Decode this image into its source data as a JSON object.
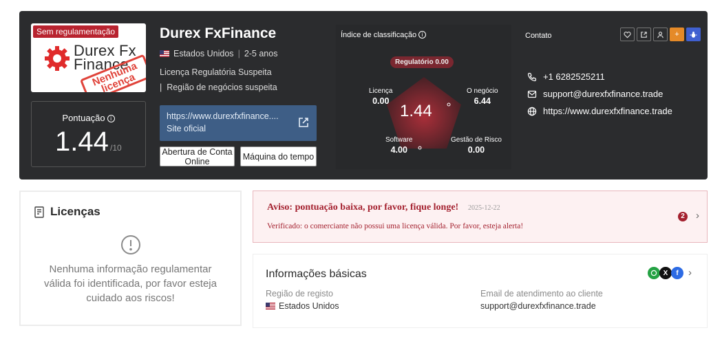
{
  "broker": {
    "unregulated_tag": "Sem regulamentação",
    "logo_text_line1": "Durex Fx",
    "logo_text_line2": "Finance",
    "stamp_line1": "Nenhuma",
    "stamp_line2": "licença",
    "name": "Durex FxFinance",
    "country": "Estados Unidos",
    "age": "2-5 anos",
    "license_status": "Licença Regulatória Suspeita",
    "region_status": "Região de negócios suspeita",
    "region_prefix": "|"
  },
  "score": {
    "label": "Pontuação",
    "value": "1.44",
    "max": "/10"
  },
  "website": {
    "url": "https://www.durexfxfinance....",
    "label": "Site oficial"
  },
  "actions": {
    "open_account": "Abertura de Conta Online",
    "time_machine": "Máquina do tempo"
  },
  "rating": {
    "title": "Índice de classificação",
    "regulatory_pill": "Regulatório 0.00",
    "center_score": "1.44",
    "axes": [
      {
        "label": "Licença",
        "value": "0.00"
      },
      {
        "label": "O negócio",
        "value": "6.44"
      },
      {
        "label": "Software",
        "value": "4.00"
      },
      {
        "label": "Gestão de Risco",
        "value": "0.00"
      }
    ]
  },
  "contact": {
    "title": "Contato",
    "phone": "+1 6282525211",
    "email": "support@durexfxfinance.trade",
    "website": "https://www.durexfxfinance.trade",
    "icons": [
      "heart-icon",
      "share-icon",
      "user-icon",
      "plus-icon",
      "bug-icon"
    ],
    "icon_colors": {
      "plus": "#e58a28",
      "bug": "#4060d0"
    }
  },
  "licenses": {
    "title": "Licenças",
    "message": "Nenhuma informação regulamentar válida foi identificada, por favor esteja cuidado aos riscos!"
  },
  "warning": {
    "title": "Aviso: pontuação baixa, por favor, fique longe!",
    "date": "2025-12-22",
    "text": "Verificado: o comerciante não possui uma licença válida. Por favor, esteja alerta!",
    "count": "2"
  },
  "basic_info": {
    "title": "Informações básicas",
    "region_label": "Região de registo",
    "region_value": "Estados Unidos",
    "email_label": "Email de atendimento ao cliente",
    "email_value": "support@durexfxfinance.trade",
    "socials": [
      "whatsapp-icon",
      "x-icon",
      "facebook-icon"
    ]
  },
  "colors": {
    "hero_bg": "#2b2c2e",
    "danger": "#a4212f",
    "site_button": "#3e5e86"
  }
}
